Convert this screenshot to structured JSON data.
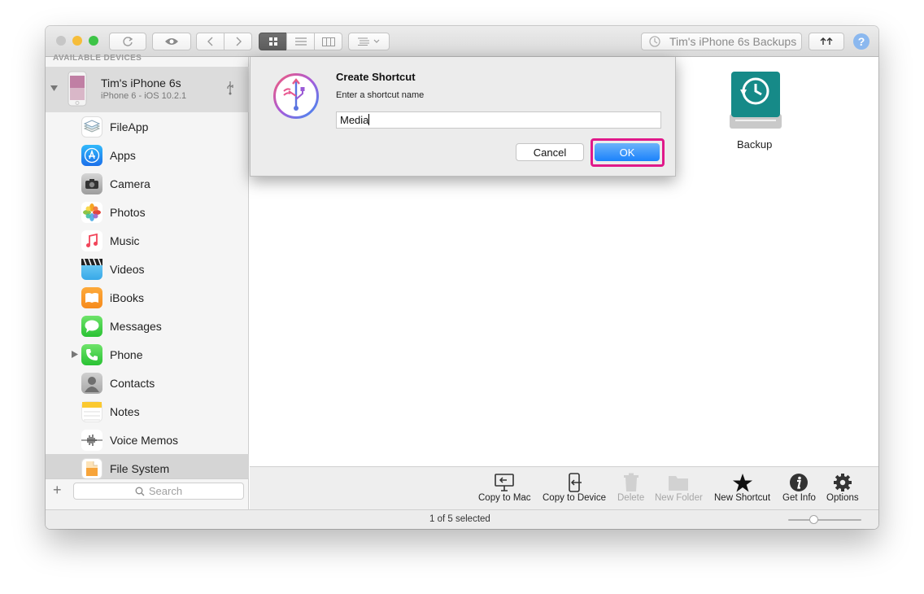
{
  "window": {
    "toolbar": {
      "backups_label": "Tim's iPhone 6s Backups",
      "help_glyph": "?"
    },
    "sidebar": {
      "section_label": "AVAILABLE DEVICES",
      "device": {
        "name": "Tim's iPhone 6s",
        "subtitle": "iPhone 6 - iOS 10.2.1"
      },
      "items": [
        {
          "label": "FileApp",
          "icon": "fileapp-icon"
        },
        {
          "label": "Apps",
          "icon": "app-store-icon"
        },
        {
          "label": "Camera",
          "icon": "camera-icon"
        },
        {
          "label": "Photos",
          "icon": "photos-icon"
        },
        {
          "label": "Music",
          "icon": "music-icon"
        },
        {
          "label": "Videos",
          "icon": "videos-icon"
        },
        {
          "label": "iBooks",
          "icon": "ibooks-icon"
        },
        {
          "label": "Messages",
          "icon": "messages-icon"
        },
        {
          "label": "Phone",
          "icon": "phone-icon"
        },
        {
          "label": "Contacts",
          "icon": "contacts-icon"
        },
        {
          "label": "Notes",
          "icon": "notes-icon"
        },
        {
          "label": "Voice Memos",
          "icon": "voice-memos-icon"
        },
        {
          "label": "File System",
          "icon": "file-system-icon"
        }
      ],
      "search_placeholder": "Search",
      "add_glyph": "+"
    },
    "main": {
      "items": [
        {
          "label": "Backup",
          "icon": "time-machine-backup-icon"
        }
      ]
    },
    "bottom_toolbar": {
      "copy_to_mac": "Copy to Mac",
      "copy_to_device": "Copy to Device",
      "delete": "Delete",
      "new_folder": "New Folder",
      "new_shortcut": "New Shortcut",
      "get_info": "Get Info",
      "options": "Options"
    },
    "status": {
      "text": "1 of 5 selected",
      "zoom_fraction": 0.35
    }
  },
  "dialog": {
    "title": "Create Shortcut",
    "prompt": "Enter a shortcut name",
    "input_value": "Media",
    "cancel_label": "Cancel",
    "ok_label": "OK"
  },
  "colors": {
    "highlight": "#e0198a",
    "ok_button": "#1a82fb"
  }
}
